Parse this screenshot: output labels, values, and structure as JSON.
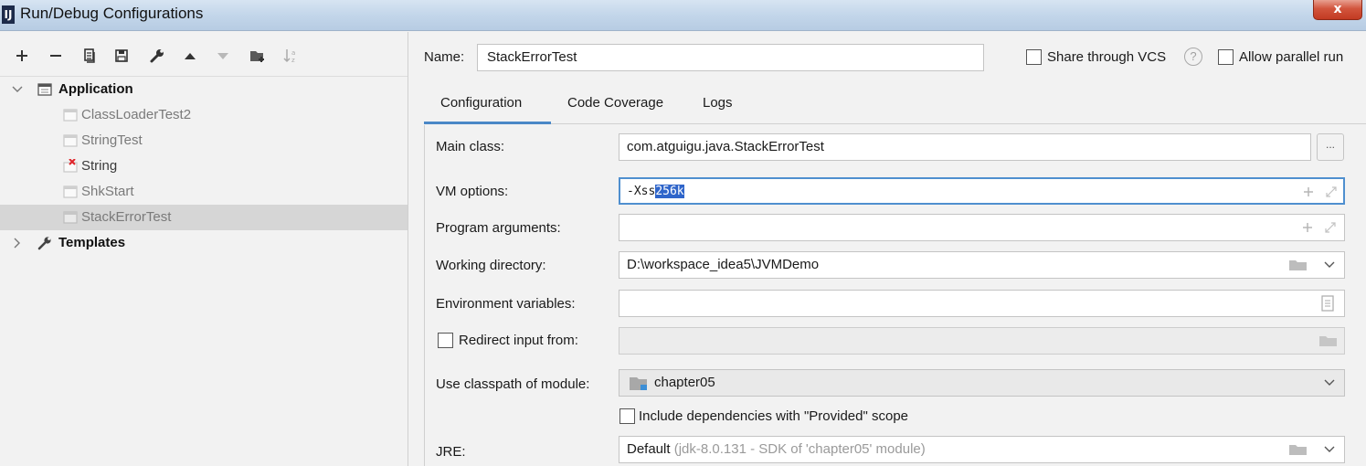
{
  "window": {
    "title": "Run/Debug Configurations",
    "app_icon": "IJ",
    "close_glyph": "x"
  },
  "toolbar": {
    "icons": [
      "add-icon",
      "remove-icon",
      "copy-icon",
      "save-icon",
      "wrench-icon",
      "move-up-icon",
      "move-down-icon",
      "folder-icon",
      "sort-icon"
    ]
  },
  "tree": {
    "application_label": "Application",
    "items": [
      {
        "label": "ClassLoaderTest2"
      },
      {
        "label": "StringTest"
      },
      {
        "label": "String"
      },
      {
        "label": "ShkStart"
      },
      {
        "label": "StackErrorTest"
      }
    ],
    "templates_label": "Templates"
  },
  "header": {
    "name_label": "Name:",
    "name_value": "StackErrorTest",
    "share_vcs_label": "Share through VCS",
    "help_glyph": "?",
    "allow_parallel_label": "Allow parallel run"
  },
  "tabs": [
    {
      "label": "Configuration"
    },
    {
      "label": "Code Coverage"
    },
    {
      "label": "Logs"
    }
  ],
  "form": {
    "main_class_label": "Main class:",
    "main_class_value": "com.atguigu.java.StackErrorTest",
    "browse_glyph": "...",
    "vm_options_label": "VM options:",
    "vm_options_prefix": "-Xss",
    "vm_options_selected": "256k",
    "program_args_label": "Program arguments:",
    "working_dir_label": "Working directory:",
    "working_dir_value": "D:\\workspace_idea5\\JVMDemo",
    "env_vars_label": "Environment variables:",
    "redirect_label": "Redirect input from:",
    "classpath_label": "Use classpath of module:",
    "classpath_value": "chapter05",
    "include_deps_label": "Include dependencies with \"Provided\" scope",
    "jre_label": "JRE:",
    "jre_value": "Default",
    "jre_detail": "(jdk-8.0.131 - SDK of 'chapter05' module)"
  },
  "colors": {
    "accent": "#4a88c7",
    "selection": "#2f65ca",
    "error": "#e0242a"
  }
}
